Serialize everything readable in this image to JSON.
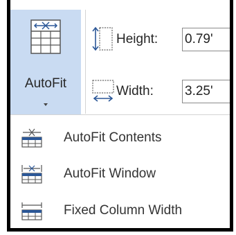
{
  "ribbon": {
    "autofit_label": "AutoFit",
    "height_label": "Height:",
    "height_value": "0.79'",
    "width_label": "Width:",
    "width_value": "3.25'"
  },
  "menu": {
    "items": [
      {
        "label": "AutoFit Contents",
        "icon": "autofit-contents-icon"
      },
      {
        "label": "AutoFit Window",
        "icon": "autofit-window-icon"
      },
      {
        "label": "Fixed Column Width",
        "icon": "fixed-column-width-icon"
      }
    ]
  },
  "colors": {
    "selected_bg": "#c9dbf2",
    "icon_blue": "#2b5797",
    "text": "#262626"
  }
}
